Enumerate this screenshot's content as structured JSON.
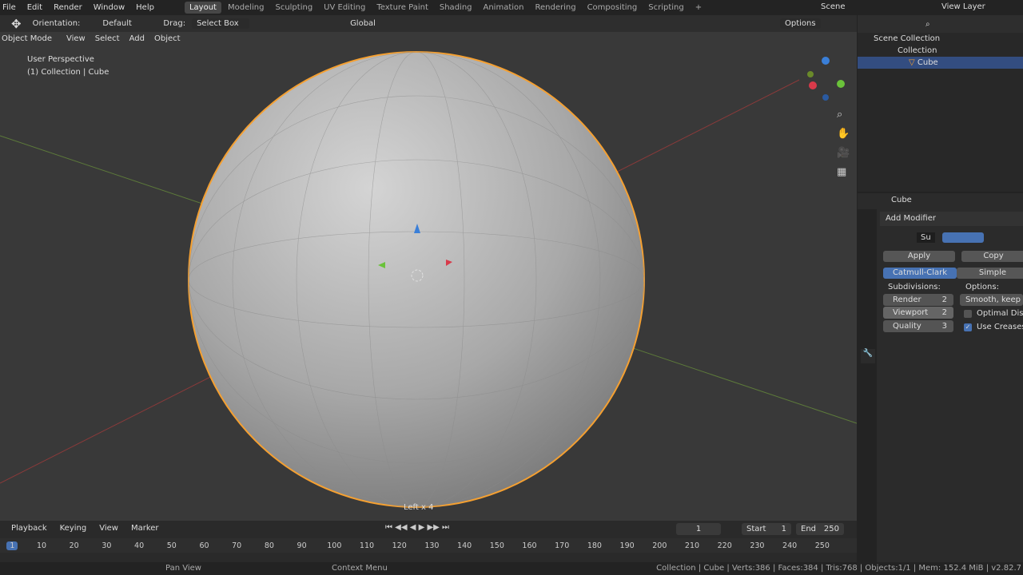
{
  "menu": [
    "File",
    "Edit",
    "Render",
    "Window",
    "Help"
  ],
  "workspaces": [
    "Layout",
    "Modeling",
    "Sculpting",
    "UV Editing",
    "Texture Paint",
    "Shading",
    "Animation",
    "Rendering",
    "Compositing",
    "Scripting",
    "+"
  ],
  "active_workspace": "Layout",
  "scene": "Scene",
  "view_layer": "View Layer",
  "tool_header": {
    "orientation_label": "Orientation:",
    "orientation": "Default",
    "drag_label": "Drag:",
    "drag": "Select Box",
    "transform": "Global",
    "options": "Options"
  },
  "viewport_header": {
    "mode": "Object Mode",
    "menus": [
      "View",
      "Select",
      "Add",
      "Object"
    ]
  },
  "overlay": {
    "perspective": "User Perspective",
    "context": "(1) Collection | Cube",
    "operation": "Left x 4"
  },
  "gizmo": {
    "x": "X",
    "y": "Y",
    "z": "Z"
  },
  "outliner": {
    "items": [
      {
        "label": "Scene Collection"
      },
      {
        "label": "Collection"
      },
      {
        "label": "Cube",
        "selected": true
      }
    ]
  },
  "properties": {
    "object": "Cube",
    "add_modifier": "Add Modifier",
    "modifier_name": "Su",
    "apply": "Apply",
    "copy": "Copy",
    "type_a": "Catmull-Clark",
    "type_b": "Simple",
    "subdivisions_label": "Subdivisions:",
    "options_label": "Options:",
    "render_label": "Render",
    "render_value": "2",
    "viewport_label": "Viewport",
    "viewport_value": "2",
    "quality_label": "Quality",
    "quality_value": "3",
    "smooth": "Smooth, keep co...",
    "optimal": "Optimal Display",
    "optimal_checked": false,
    "creases": "Use Creases",
    "creases_checked": true
  },
  "timeline": {
    "menus": [
      "Playback",
      "Keying",
      "View",
      "Marker"
    ],
    "current": "1",
    "start_label": "Start",
    "start": "1",
    "end_label": "End",
    "end": "250",
    "ticks": [
      1,
      10,
      20,
      30,
      40,
      50,
      60,
      70,
      80,
      90,
      100,
      110,
      120,
      130,
      140,
      150,
      160,
      170,
      180,
      190,
      200,
      210,
      220,
      230,
      240,
      250
    ]
  },
  "status": {
    "left": "Pan View",
    "mid": "Context Menu",
    "stats": "Collection | Cube | Verts:386 | Faces:384 | Tris:768 | Objects:1/1 | Mem: 152.4 MiB | v2.82.7"
  },
  "colors": {
    "accent": "#4772b3",
    "selection": "#f5a031"
  }
}
